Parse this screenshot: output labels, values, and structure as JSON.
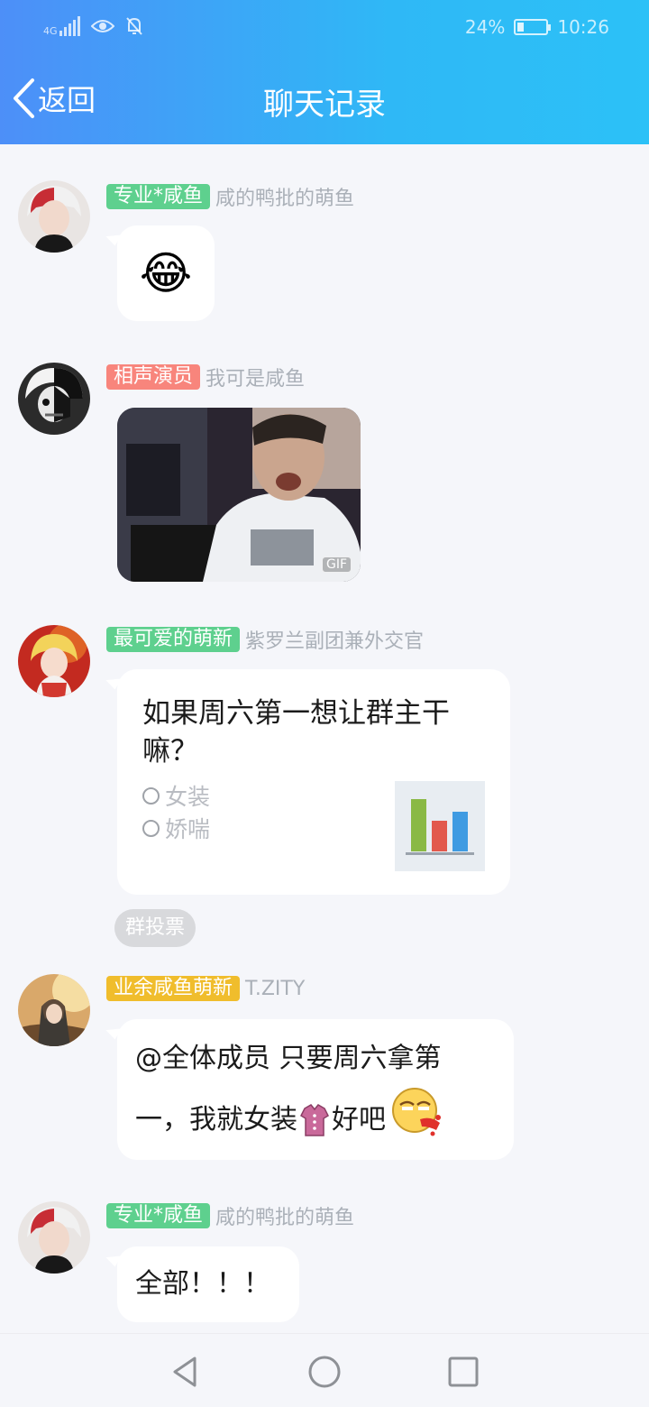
{
  "status_bar": {
    "network": "4G",
    "battery_pct": "24%",
    "time": "10:26",
    "battery_level": 0.24
  },
  "header": {
    "back_label": "返回",
    "title": "聊天记录"
  },
  "messages": [
    {
      "badge": "专业*咸鱼",
      "badge_color": "#5ed08e",
      "sender": "咸的鸭批的萌鱼",
      "type": "emoji",
      "emoji": "😂"
    },
    {
      "badge": "相声演员",
      "badge_color": "#f8857c",
      "sender": "我可是咸鱼",
      "type": "gif",
      "gif_label": "GIF"
    },
    {
      "badge": "最可爱的萌新",
      "badge_color": "#5ed08e",
      "sender": "紫罗兰副团兼外交官",
      "type": "poll",
      "question": "如果周六第一想让群主干嘛？",
      "options": [
        "女装",
        "娇喘"
      ],
      "poll_tag": "群投票"
    },
    {
      "badge": "业余咸鱼萌新",
      "badge_color": "#f0bd2c",
      "sender": "T.ZITY",
      "type": "text",
      "line1": "@全体成员 只要周六拿第",
      "line2a": "一，我就女装",
      "line2b": "好吧"
    },
    {
      "badge": "专业*咸鱼",
      "badge_color": "#5ed08e",
      "sender": "咸的鸭批的萌鱼",
      "type": "text",
      "text": "全部！！！"
    }
  ],
  "icons": {
    "back": "chevron-left-icon",
    "nav_back": "triangle-back-icon",
    "nav_home": "circle-home-icon",
    "nav_recent": "square-recent-icon"
  }
}
